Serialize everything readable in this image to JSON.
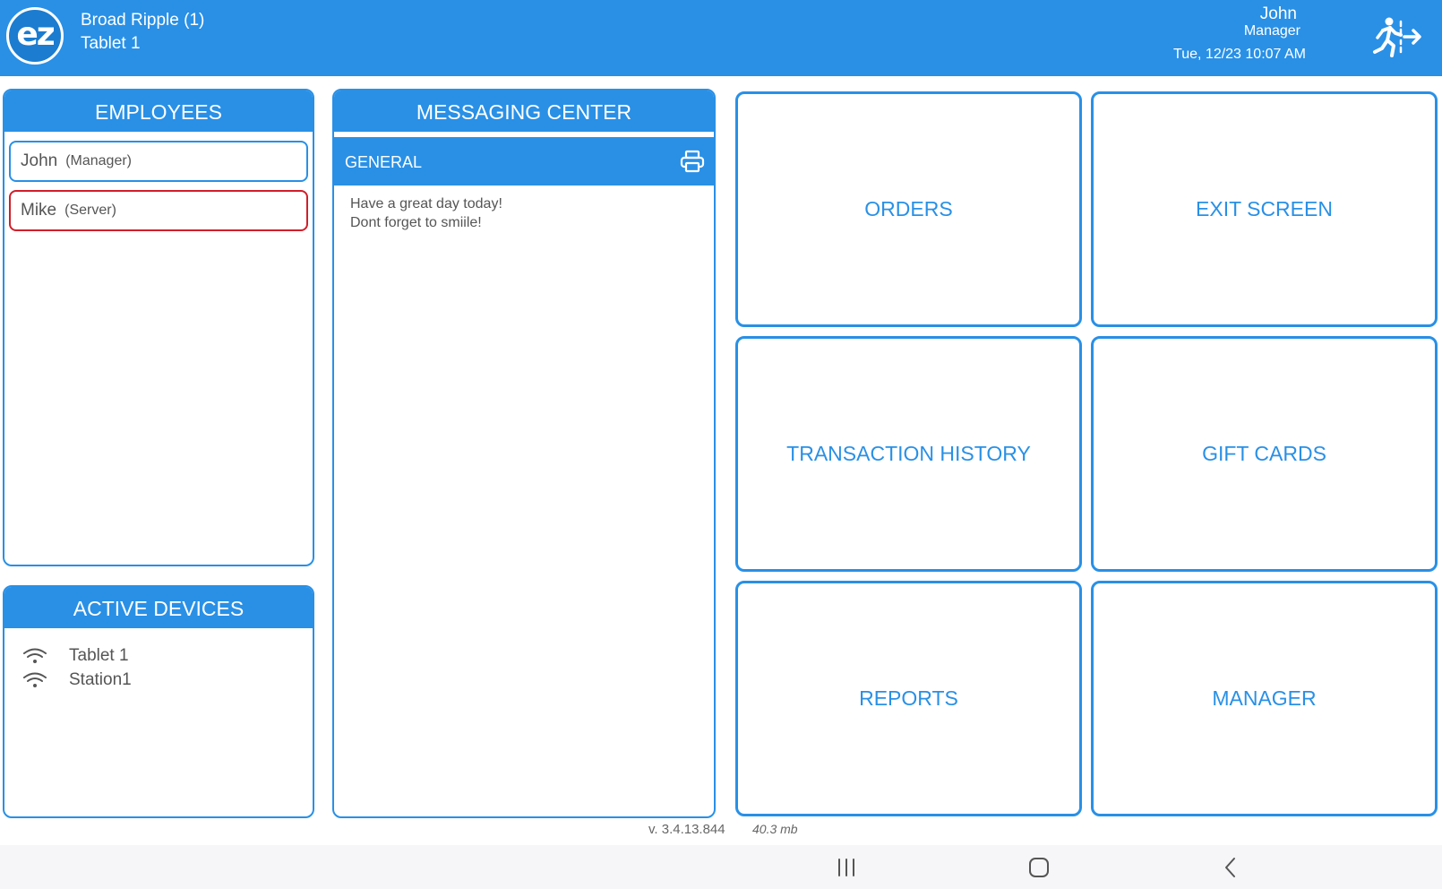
{
  "header": {
    "logo_text": "ez",
    "store_name": "Broad Ripple (1)",
    "device_name": "Tablet 1",
    "user_name": "John",
    "user_role": "Manager",
    "datetime": "Tue, 12/23 10:07 AM",
    "logout_icon": "exit-person-icon"
  },
  "employees": {
    "title": "EMPLOYEES",
    "items": [
      {
        "name": "John",
        "role": "(Manager)",
        "border_color": "#2990e6"
      },
      {
        "name": "Mike",
        "role": "(Server)",
        "border_color": "#d01f2a"
      }
    ]
  },
  "active_devices": {
    "title": "ACTIVE DEVICES",
    "items": [
      {
        "name": "Tablet 1",
        "icon": "wifi-icon"
      },
      {
        "name": "Station1",
        "icon": "wifi-icon"
      }
    ]
  },
  "messaging": {
    "title": "MESSAGING CENTER",
    "channel": "GENERAL",
    "print_icon": "printer-icon",
    "lines": [
      "Have a great day today!",
      "Dont forget to smiile!"
    ]
  },
  "tiles": {
    "orders": "ORDERS",
    "exit_screen": "EXIT SCREEN",
    "transaction_history": "TRANSACTION HISTORY",
    "gift_cards": "GIFT CARDS",
    "reports": "REPORTS",
    "manager": "MANAGER"
  },
  "footer": {
    "version": "v. 3.4.13.844",
    "memory": "40.3  mb"
  },
  "colors": {
    "accent": "#2990e6",
    "alert": "#d01f2a"
  }
}
